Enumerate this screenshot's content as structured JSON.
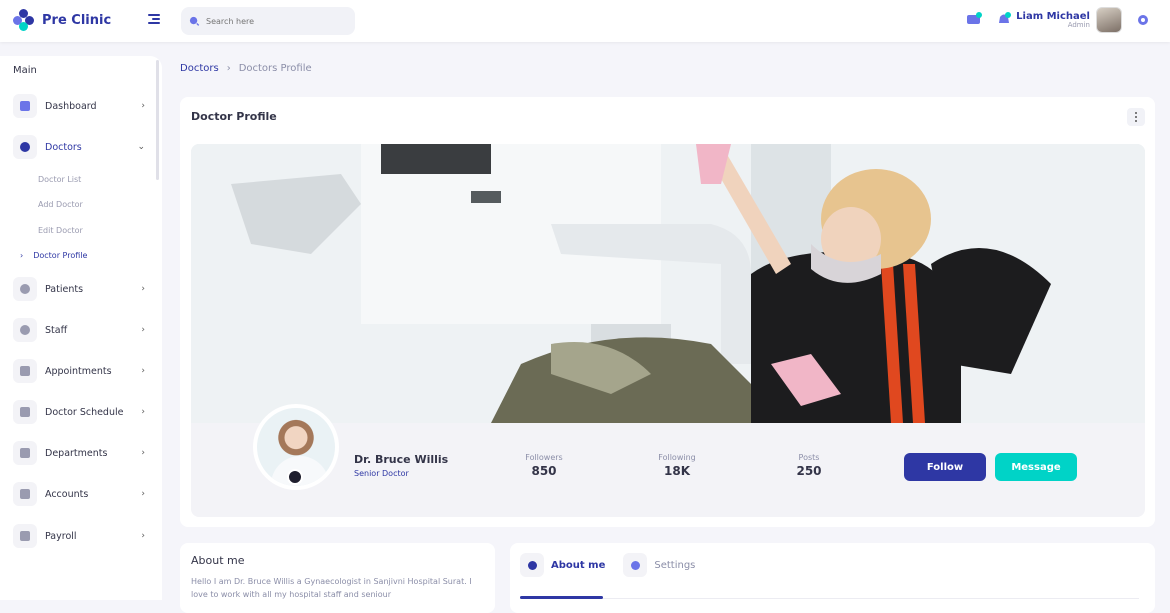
{
  "brand": {
    "name": "Pre Clinic"
  },
  "search": {
    "placeholder": "Search here"
  },
  "user": {
    "name": "Liam Michael",
    "role": "Admin"
  },
  "sidebar": {
    "heading": "Main",
    "items": [
      {
        "label": "Dashboard"
      },
      {
        "label": "Doctors"
      },
      {
        "label": "Patients"
      },
      {
        "label": "Staff"
      },
      {
        "label": "Appointments"
      },
      {
        "label": "Doctor Schedule"
      },
      {
        "label": "Departments"
      },
      {
        "label": "Accounts"
      },
      {
        "label": "Payroll"
      }
    ],
    "doctor_sub": [
      {
        "label": "Doctor List"
      },
      {
        "label": "Add Doctor"
      },
      {
        "label": "Edit Doctor"
      },
      {
        "label": "Doctor Profile"
      }
    ]
  },
  "breadcrumb": {
    "parent": "Doctors",
    "current": "Doctors Profile",
    "separator": "›"
  },
  "profile_card": {
    "title": "Doctor Profile",
    "name": "Dr. Bruce Willis",
    "role": "Senior Doctor",
    "stats": [
      {
        "label": "Followers",
        "value": "850"
      },
      {
        "label": "Following",
        "value": "18K"
      },
      {
        "label": "Posts",
        "value": "250"
      }
    ],
    "follow_label": "Follow",
    "message_label": "Message"
  },
  "about": {
    "title": "About me",
    "text": "Hello I am Dr. Bruce Willis a Gynaecologist in Sanjivni Hospital Surat. I love to work with all my hospital staff and seniour"
  },
  "tabs": [
    {
      "label": "About me"
    },
    {
      "label": "Settings"
    }
  ],
  "colors": {
    "primary": "#2e37a4",
    "accent": "#00d3c7",
    "background": "#f5f5fa"
  }
}
